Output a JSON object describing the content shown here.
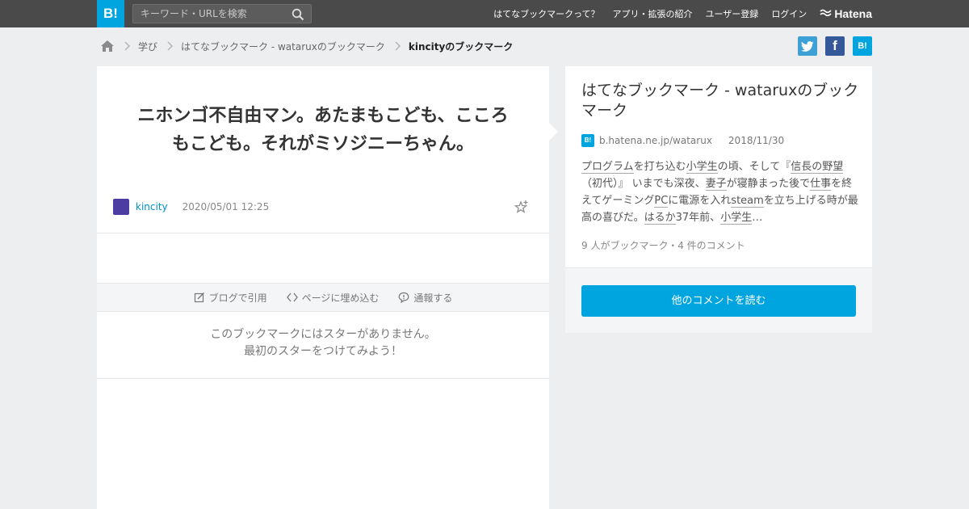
{
  "header": {
    "logo": "B!",
    "search_placeholder": "キーワード・URLを検索",
    "nav": [
      "はてなブックマークって？",
      "アプリ・拡張の紹介",
      "ユーザー登録",
      "ログイン"
    ],
    "brand": "Hatena"
  },
  "breadcrumb": {
    "items": [
      "学び",
      "はてなブックマーク - wataruxのブックマーク"
    ],
    "current": "kincityのブックマーク"
  },
  "share": {
    "facebook_glyph": "f",
    "hatena_glyph": "B!"
  },
  "bookmark": {
    "comment": "ニホンゴ不自由マン。あたまもこども、こころもこども。それがミソジニーちゃん。",
    "user": "kincity",
    "date": "2020/05/01 12:25",
    "actions": {
      "quote": "ブログで引用",
      "embed": "ページに埋め込む",
      "report": "通報する"
    },
    "no_star": {
      "line1": "このブックマークにはスターがありません。",
      "line2": "最初のスターをつけてみよう！"
    }
  },
  "entry": {
    "title": "はてなブックマーク - wataruxのブックマーク",
    "favicon": "B!",
    "domain": "b.hatena.ne.jp/watarux",
    "date": "2018/11/30",
    "description": {
      "w1": "プログラム",
      "t1": "を打ち込む",
      "w2": "小学生",
      "t2": "の頃、そして『",
      "w3": "信長の野望",
      "t3": "（初代）』 いまでも深夜、",
      "w4": "妻子",
      "t4": "が寝静まった後で",
      "w5": "仕事",
      "t5": "を終えてゲーミング",
      "w6": "PC",
      "t6": "に電源を入れ",
      "w7": "steam",
      "t7": "を立ち上げる時が最高の喜びだ。",
      "w8": "はるか",
      "t8": "37年前、",
      "w9": "小学生",
      "t9": "…"
    },
    "counts": "9 人がブックマーク・4 件のコメント",
    "more_button": "他のコメントを読む"
  },
  "colors": {
    "topbar": "#4a4a4a",
    "brand_blue": "#00a4de",
    "link_blue": "#008dcb",
    "twitter": "#3ea1d6",
    "facebook": "#35589a",
    "avatar": "#4b3da2"
  },
  "icons": [
    "search-icon",
    "home-icon",
    "chevron-right-icon",
    "twitter-icon",
    "facebook-icon",
    "hatena-bookmark-icon",
    "add-star-icon",
    "edit-icon",
    "code-icon",
    "speech-bubble-icon",
    "hatena-logo-icon"
  ]
}
